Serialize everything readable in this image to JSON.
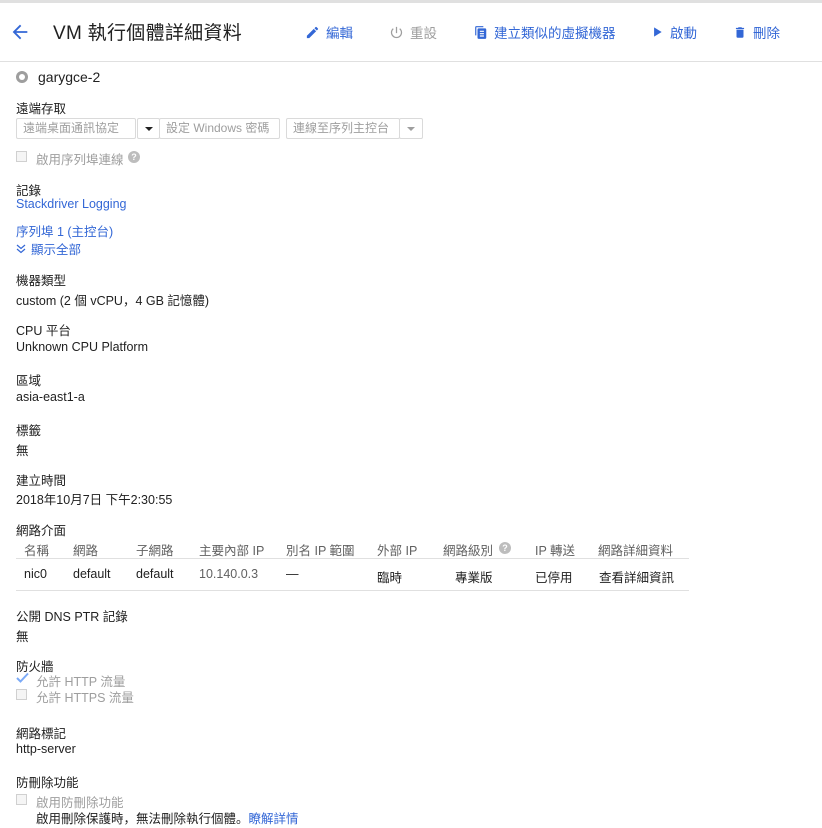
{
  "header": {
    "title": "VM 執行個體詳細資料",
    "actions": {
      "edit": "編輯",
      "reset": "重設",
      "create_similar": "建立類似的虛擬機器",
      "start": "啟動",
      "delete": "刪除"
    }
  },
  "instance": {
    "name": "garygce-2"
  },
  "remote_access": {
    "heading": "遠端存取",
    "rdp": "遠端桌面通訊協定",
    "set_windows_password": "設定 Windows 密碼",
    "serial_console": "連線至序列主控台",
    "enable_serial": "啟用序列埠連線"
  },
  "logs": {
    "heading": "記錄",
    "stackdriver": "Stackdriver Logging",
    "serial_port": "序列埠 1 (主控台)",
    "show_all": "顯示全部"
  },
  "machine_type": {
    "heading": "機器類型",
    "value": "custom (2 個 vCPU，4 GB 記憶體)"
  },
  "cpu_platform": {
    "heading": "CPU 平台",
    "value": "Unknown CPU Platform"
  },
  "zone": {
    "heading": "區域",
    "value": "asia-east1-a"
  },
  "labels": {
    "heading": "標籤",
    "value": "無"
  },
  "creation_time": {
    "heading": "建立時間",
    "value": "2018年10月7日 下午2:30:55"
  },
  "network_interfaces": {
    "heading": "網路介面",
    "columns": [
      "名稱",
      "網路",
      "子網路",
      "主要內部 IP",
      "別名 IP 範圍",
      "外部 IP",
      "網路級別",
      "IP 轉送",
      "網路詳細資料"
    ],
    "rows": [
      [
        "nic0",
        "default",
        "default",
        "10.140.0.3",
        "—",
        "臨時",
        "專業版",
        "已停用",
        "查看詳細資訊"
      ]
    ]
  },
  "public_dns": {
    "heading": "公開 DNS PTR 記錄",
    "value": "無"
  },
  "firewall": {
    "heading": "防火牆",
    "http": "允許 HTTP 流量",
    "https": "允許 HTTPS 流量"
  },
  "network_tags": {
    "heading": "網路標記",
    "value": "http-server"
  },
  "deletion_protection": {
    "heading": "防刪除功能",
    "enable": "啟用防刪除功能",
    "note": "啟用刪除保護時，無法刪除執行個體。",
    "learn_more": "瞭解詳情"
  },
  "colors": {
    "link": "#3367d6",
    "disabled": "#9e9e9e",
    "divider": "#e0e0e0"
  }
}
